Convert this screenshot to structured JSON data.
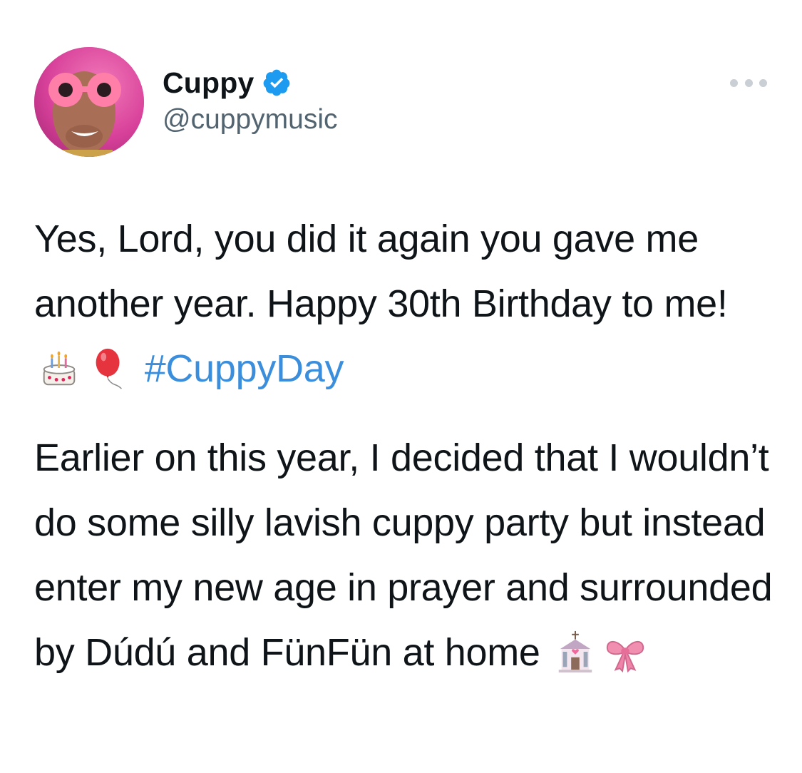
{
  "author": {
    "display_name": "Cuppy",
    "handle": "@cuppymusic",
    "verified": true,
    "avatar_icon": "profile-photo"
  },
  "menu": {
    "icon": "more-options-icon"
  },
  "tweet": {
    "paragraph1": {
      "text_a": "Yes, Lord, you did it again you gave me another year. Happy 30th Birthday to me!",
      "emoji1": "birthday-cake-emoji",
      "emoji2": "balloon-emoji",
      "hashtag": "#CuppyDay"
    },
    "paragraph2": {
      "text_a": "Earlier on this year, I decided that I wouldn’t do some silly lavish cuppy party but instead enter my new age in prayer and surrounded by Dúdú and FünFün at home",
      "emoji1": "wedding-chapel-emoji",
      "emoji2": "ribbon-emoji"
    }
  },
  "colors": {
    "text": "#0f1419",
    "secondary": "#536471",
    "link": "#3a8edb",
    "verified_badge": "#1d9bf0"
  }
}
